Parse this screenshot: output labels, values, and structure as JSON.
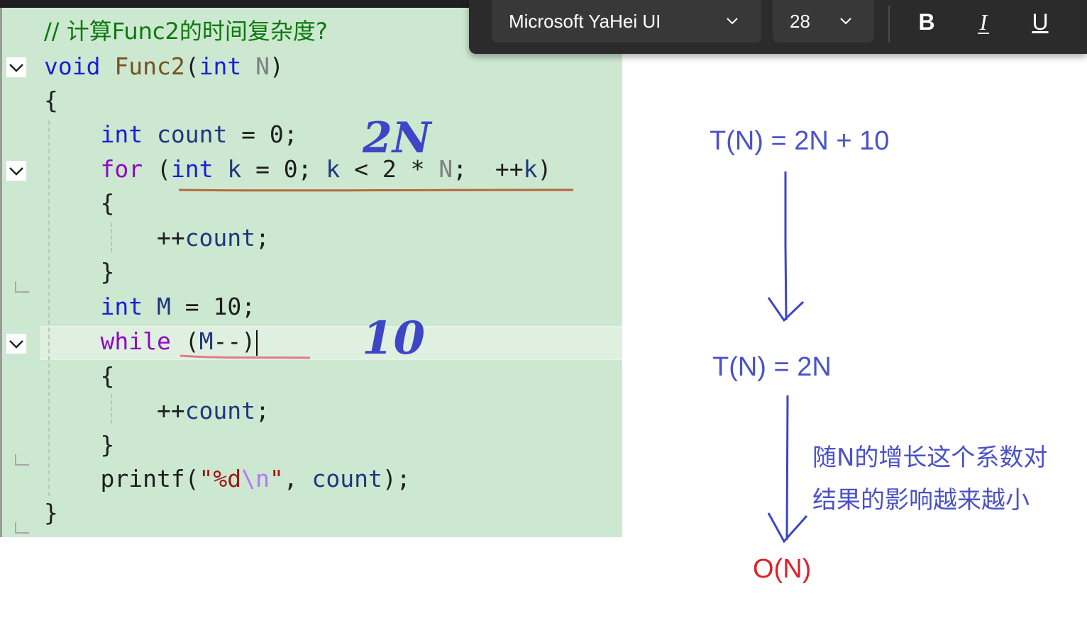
{
  "toolbar": {
    "font_family": "Microsoft YaHei UI",
    "font_size": "28",
    "bold_label": "B",
    "italic_label": "I",
    "underline_label": "U"
  },
  "code": {
    "comment": "// 计算Func2的时间复杂度?",
    "lines": [
      {
        "tokens": [
          [
            "kw",
            "void"
          ],
          [
            "plain",
            " "
          ],
          [
            "fn",
            "Func2"
          ],
          [
            "plain",
            "("
          ],
          [
            "kw",
            "int"
          ],
          [
            "plain",
            " "
          ],
          [
            "param",
            "N"
          ],
          [
            "plain",
            ")"
          ]
        ]
      },
      {
        "tokens": [
          [
            "plain",
            "{"
          ]
        ]
      },
      {
        "tokens": [
          [
            "plain",
            "    "
          ],
          [
            "kw",
            "int"
          ],
          [
            "plain",
            " "
          ],
          [
            "var",
            "count"
          ],
          [
            "plain",
            " = 0;"
          ]
        ]
      },
      {
        "tokens": [
          [
            "plain",
            "    "
          ],
          [
            "ctl",
            "for"
          ],
          [
            "plain",
            " ("
          ],
          [
            "kw",
            "int"
          ],
          [
            "plain",
            " "
          ],
          [
            "var",
            "k"
          ],
          [
            "plain",
            " = 0; "
          ],
          [
            "var",
            "k"
          ],
          [
            "plain",
            " < 2 * "
          ],
          [
            "param",
            "N"
          ],
          [
            "plain",
            ";  ++"
          ],
          [
            "var",
            "k"
          ],
          [
            "plain",
            ")"
          ]
        ]
      },
      {
        "tokens": [
          [
            "plain",
            "    {"
          ]
        ]
      },
      {
        "tokens": [
          [
            "plain",
            "        ++"
          ],
          [
            "var",
            "count"
          ],
          [
            "plain",
            ";"
          ]
        ]
      },
      {
        "tokens": [
          [
            "plain",
            "    }"
          ]
        ]
      },
      {
        "tokens": [
          [
            "plain",
            "    "
          ],
          [
            "kw",
            "int"
          ],
          [
            "plain",
            " "
          ],
          [
            "var",
            "M"
          ],
          [
            "plain",
            " = 10;"
          ]
        ]
      },
      {
        "tokens": [
          [
            "plain",
            "    "
          ],
          [
            "ctl",
            "while"
          ],
          [
            "plain",
            " ("
          ],
          [
            "var",
            "M"
          ],
          [
            "plain",
            "--)"
          ]
        ]
      },
      {
        "tokens": [
          [
            "plain",
            "    {"
          ]
        ]
      },
      {
        "tokens": [
          [
            "plain",
            "        ++"
          ],
          [
            "var",
            "count"
          ],
          [
            "plain",
            ";"
          ]
        ]
      },
      {
        "tokens": [
          [
            "plain",
            "    }"
          ]
        ]
      },
      {
        "tokens": [
          [
            "plain",
            "    printf("
          ],
          [
            "str",
            "\"%d"
          ],
          [
            "esc",
            "\\n"
          ],
          [
            "str",
            "\""
          ],
          [
            "plain",
            ", "
          ],
          [
            "var",
            "count"
          ],
          [
            "plain",
            ");"
          ]
        ]
      },
      {
        "tokens": [
          [
            "plain",
            "}"
          ]
        ]
      }
    ]
  },
  "annotations": {
    "handwritten_for": "2N",
    "handwritten_while": "10",
    "step1": "T(N) = 2N + 10",
    "step2": "T(N) = 2N",
    "note_line1": "随N的增长这个系数对",
    "note_line2": "结果的影响越来越小",
    "result": "O(N)"
  },
  "colors": {
    "editor_bg": "#cde8d1",
    "keyword": "#1b1fd6",
    "control": "#8f08c4",
    "annotation_blue": "#4a52c9",
    "result_red": "#e0202a",
    "toolbar_bg": "#2b2b2b"
  }
}
